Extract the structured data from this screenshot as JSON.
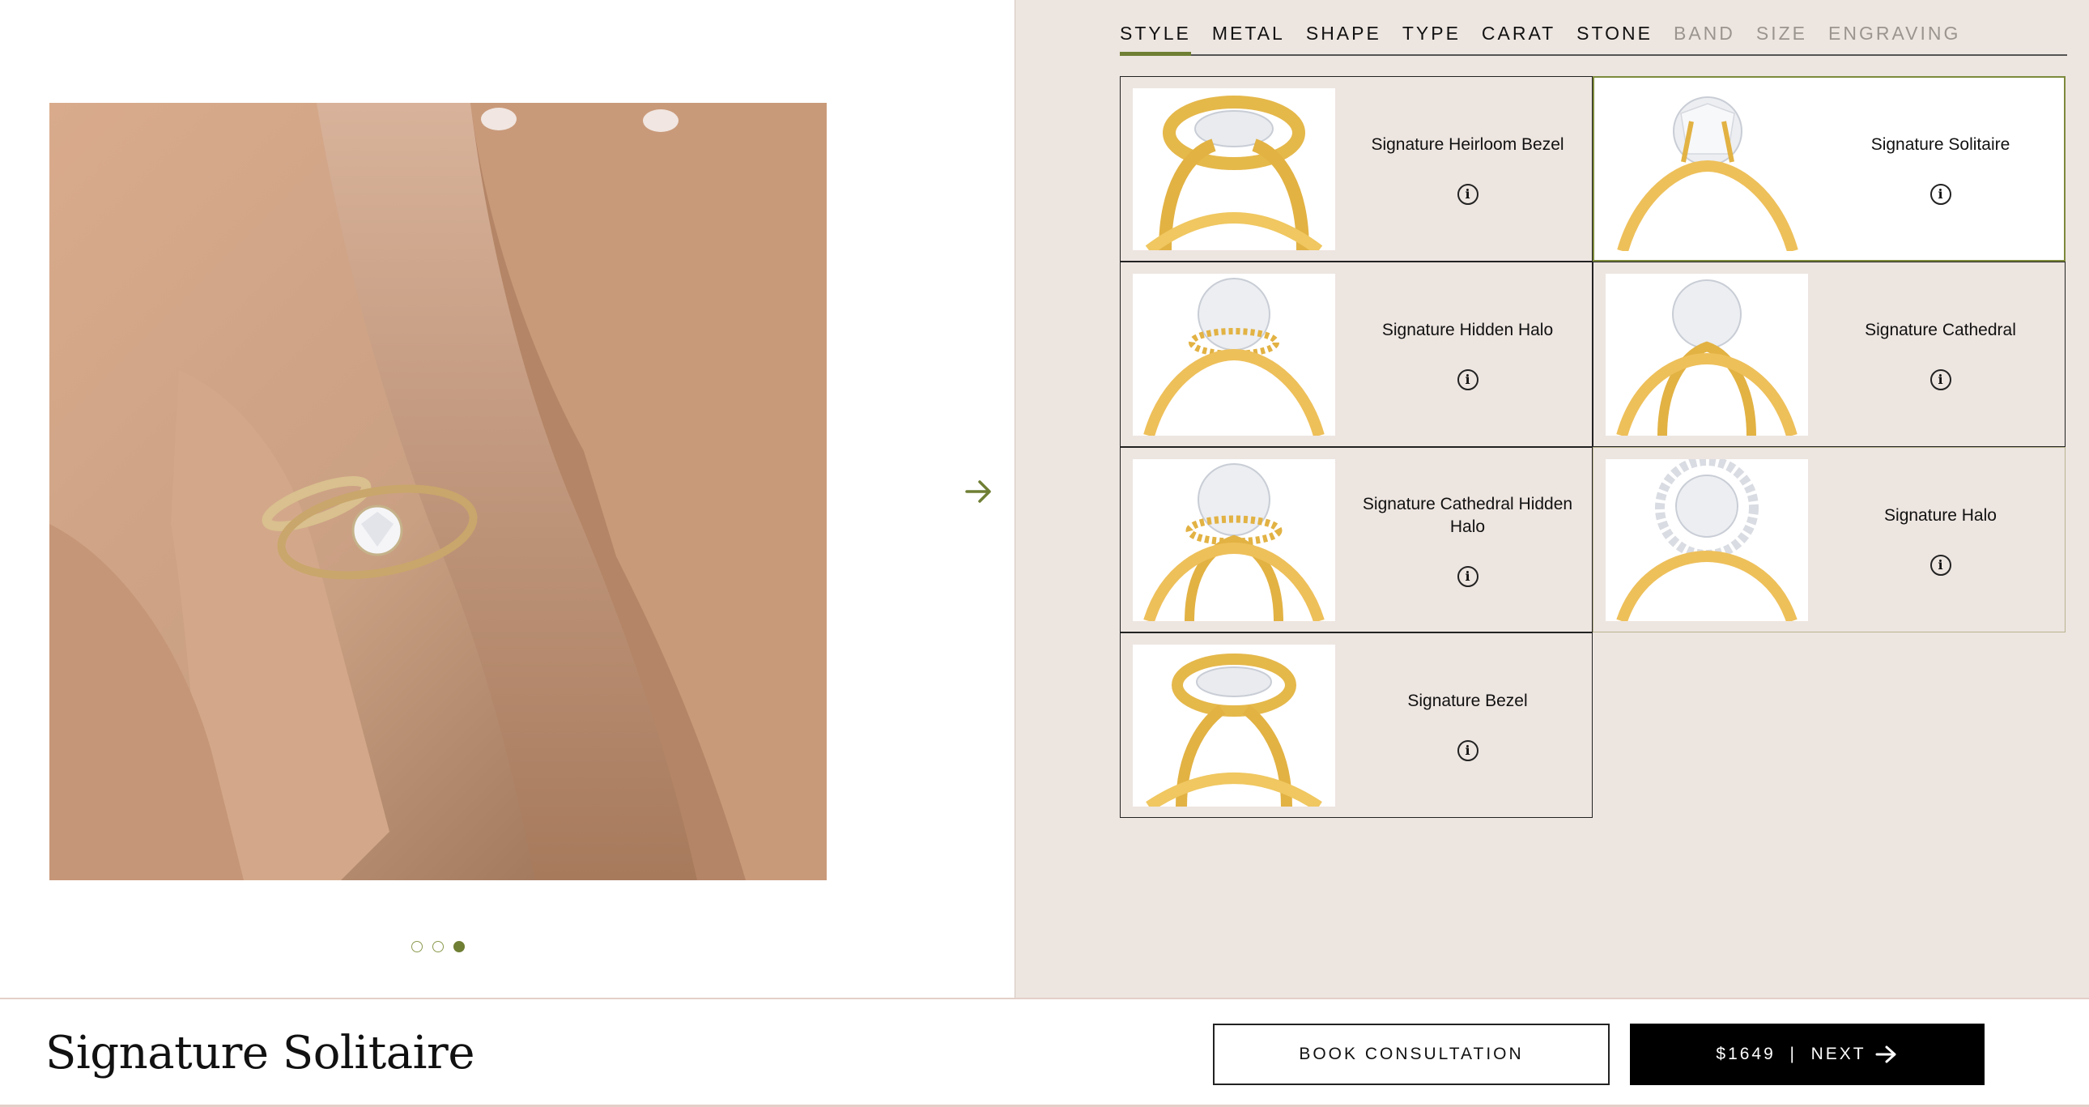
{
  "tabs": [
    {
      "label": "STYLE",
      "state": "active"
    },
    {
      "label": "METAL",
      "state": "enabled"
    },
    {
      "label": "SHAPE",
      "state": "enabled"
    },
    {
      "label": "TYPE",
      "state": "enabled"
    },
    {
      "label": "CARAT",
      "state": "enabled"
    },
    {
      "label": "STONE",
      "state": "enabled"
    },
    {
      "label": "BAND",
      "state": "disabled"
    },
    {
      "label": "SIZE",
      "state": "disabled"
    },
    {
      "label": "ENGRAVING",
      "state": "disabled"
    }
  ],
  "styles": [
    {
      "name": "Signature Heirloom Bezel",
      "info_icon": "info-icon",
      "selected": false
    },
    {
      "name": "Signature Solitaire",
      "info_icon": "info-icon",
      "selected": true
    },
    {
      "name": "Signature Hidden Halo",
      "info_icon": "info-icon",
      "selected": false
    },
    {
      "name": "Signature Cathedral",
      "info_icon": "info-icon",
      "selected": false
    },
    {
      "name": "Signature Cathedral Hidden Halo",
      "info_icon": "info-icon",
      "selected": false
    },
    {
      "name": "Signature Halo",
      "info_icon": "info-icon",
      "selected": false
    },
    {
      "name": "Signature Bezel",
      "info_icon": "info-icon",
      "selected": false
    }
  ],
  "gallery": {
    "next_icon": "arrow-right-icon",
    "dots": 3,
    "active_dot": 3
  },
  "footer": {
    "product_title": "Signature Solitaire",
    "consult_label": "BOOK CONSULTATION",
    "next_label": "$1649  |  NEXT",
    "next_icon": "arrow-right-icon"
  },
  "colors": {
    "accent": "#6f7f34",
    "panel_bg": "#ede5e0",
    "gold": "#e8b94a"
  }
}
